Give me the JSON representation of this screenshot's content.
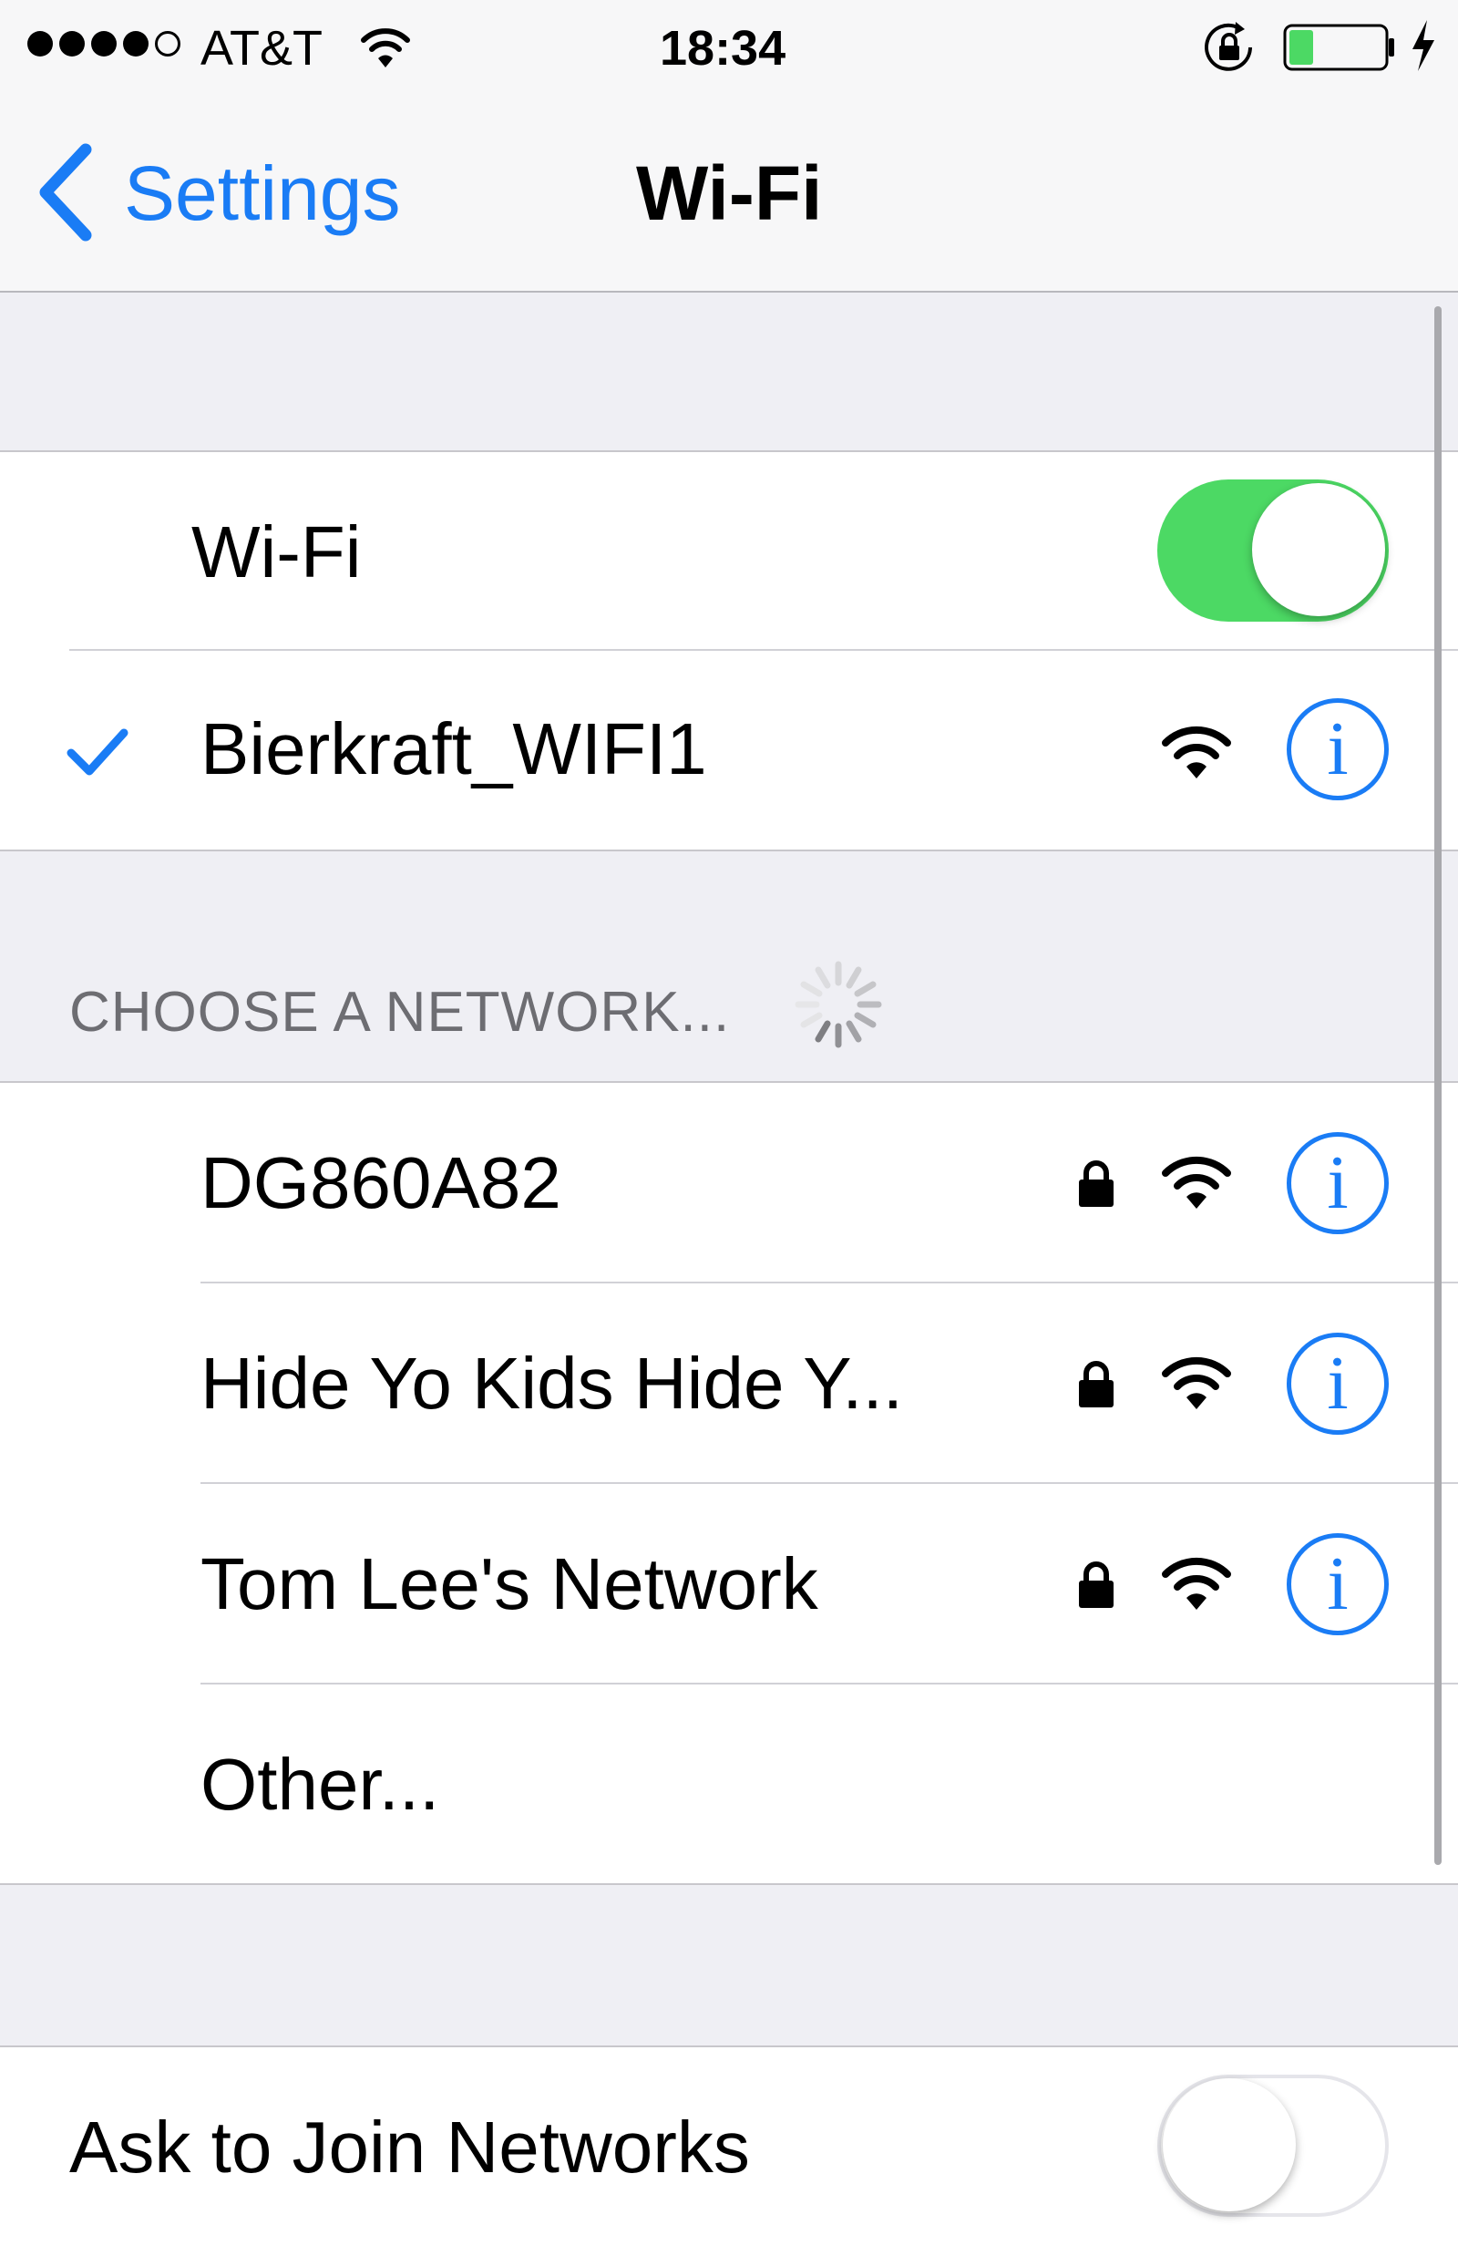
{
  "status_bar": {
    "carrier": "AT&T",
    "time": "18:34",
    "signal_bars_filled": 4,
    "signal_bars_total": 5,
    "battery_level": 0.25,
    "battery_color": "#4cd964",
    "charging": true
  },
  "nav": {
    "back_label": "Settings",
    "title": "Wi-Fi"
  },
  "wifi_toggle": {
    "label": "Wi-Fi",
    "on": true
  },
  "connected_network": {
    "name": "Bierkraft_WIFI1",
    "info_symbol": "i"
  },
  "network_section": {
    "header": "CHOOSE A NETWORK...",
    "networks": [
      {
        "name": "DG860A82",
        "secured": true,
        "info_symbol": "i"
      },
      {
        "name": "Hide Yo Kids Hide Y...",
        "secured": true,
        "info_symbol": "i"
      },
      {
        "name": "Tom Lee's Network",
        "secured": true,
        "info_symbol": "i"
      }
    ],
    "other_label": "Other..."
  },
  "ask_to_join": {
    "label": "Ask to Join Networks",
    "on": false
  },
  "colors": {
    "accent": "#1a7cf5",
    "toggle_on": "#4cd964",
    "group_background": "#efeff4"
  },
  "icons": [
    "wifi-icon",
    "lock-icon",
    "checkmark-icon",
    "info-icon",
    "chevron-left-icon",
    "rotation-lock-icon",
    "battery-icon",
    "charging-bolt-icon",
    "activity-spinner-icon"
  ]
}
